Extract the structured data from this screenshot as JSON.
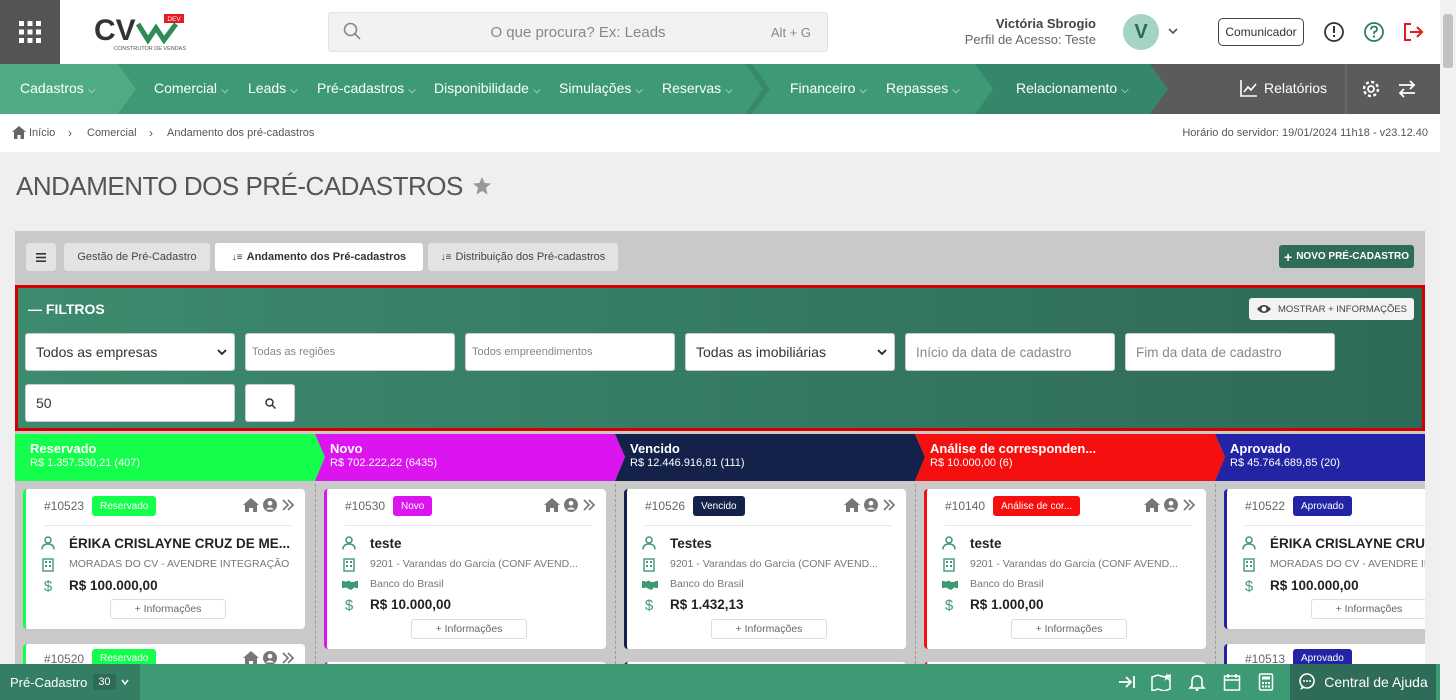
{
  "header": {
    "search_placeholder": "O que procura? Ex: Leads",
    "search_shortcut": "Alt + G",
    "user_name": "Victória Sbrogio",
    "user_profile": "Perfil de Acesso: Teste",
    "avatar_letter": "V",
    "communicator_label": "Comunicador",
    "logo_text": "CV",
    "logo_badge": "DEV",
    "logo_subtitle": "CONSTRUTOR DE VENDAS"
  },
  "nav": {
    "items": [
      "Cadastros",
      "Comercial",
      "Leads",
      "Pré-cadastros",
      "Disponibilidade",
      "Simulações",
      "Reservas",
      "Financeiro",
      "Repasses",
      "Relacionamento"
    ],
    "reports_label": "Relatórios"
  },
  "breadcrumb": {
    "items": [
      "Início",
      "Comercial",
      "Andamento dos pré-cadastros"
    ],
    "server_time": "Horário do servidor: 19/01/2024 11h18 - v23.12.40"
  },
  "page": {
    "title": "ANDAMENTO DOS PRÉ-CADASTROS"
  },
  "tabs": {
    "items": [
      "Gestão de Pré-Cadastro",
      "Andamento dos Pré-cadastros",
      "Distribuição dos Pré-cadastros"
    ],
    "active": "Andamento dos Pré-cadastros",
    "new_button": "NOVO PRÉ-CADASTRO"
  },
  "filters": {
    "title": "FILTROS",
    "more_info": "MOSTRAR + INFORMAÇÕES",
    "empresas": "Todos as empresas",
    "regioes_placeholder": "Todas as regiões",
    "empreendimentos_placeholder": "Todos empreendimentos",
    "imobiliarias": "Todas as imobiliárias",
    "data_inicio_placeholder": "Início da data de cadastro",
    "data_fim_placeholder": "Fim da data de cadastro",
    "limit_value": "50"
  },
  "columns": [
    {
      "name": "Reservado",
      "summary": "R$ 1.357.530,21 (407)",
      "color": "#14ff4c",
      "card": {
        "id": "#10523",
        "badge": "Reservado",
        "name": "ÉRIKA CRISLAYNE CRUZ DE ME...",
        "empreendimento": "MORADAS DO CV - AVENDRE INTEGRAÇÃO",
        "bank": "",
        "value": "R$ 100.000,00",
        "info": "+ Informações"
      },
      "card2": {
        "id": "#10520",
        "badge": "Reservado"
      }
    },
    {
      "name": "Novo",
      "summary": "R$ 702.222,22 (6435)",
      "color": "#dc14f0",
      "card": {
        "id": "#10530",
        "badge": "Novo",
        "name": "teste",
        "empreendimento": "9201 - Varandas do Garcia (CONF AVEND...",
        "bank": "Banco do Brasil",
        "value": "R$ 10.000,00",
        "info": "+ Informações"
      },
      "card2": {
        "id": "",
        "badge": ""
      }
    },
    {
      "name": "Vencido",
      "summary": "R$ 12.446.916,81 (111)",
      "color": "#14214b",
      "card": {
        "id": "#10526",
        "badge": "Vencido",
        "name": "Testes",
        "empreendimento": "9201 - Varandas do Garcia (CONF AVEND...",
        "bank": "Banco do Brasil",
        "value": "R$ 1.432,13",
        "info": "+ Informações"
      },
      "card2": {
        "id": "",
        "badge": ""
      }
    },
    {
      "name": "Análise de corresponden...",
      "summary": "R$ 10.000,00 (6)",
      "color": "#f50f0f",
      "card": {
        "id": "#10140",
        "badge": "Análise de cor...",
        "name": "teste",
        "empreendimento": "9201 - Varandas do Garcia (CONF AVEND...",
        "bank": "Banco do Brasil",
        "value": "R$ 1.000,00",
        "info": "+ Informações"
      },
      "card2": {
        "id": "",
        "badge": ""
      }
    },
    {
      "name": "Aprovado",
      "summary": "R$ 45.764.689,85 (20)",
      "color": "#2323a5",
      "card": {
        "id": "#10522",
        "badge": "Aprovado",
        "name": "ÉRIKA CRISLAYNE CRUZ DE ME...",
        "empreendimento": "MORADAS DO CV - AVENDRE INTEGRAÇÃO",
        "bank": "",
        "value": "R$ 100.000,00",
        "info": "+ Informações"
      },
      "card2": {
        "id": "#10513",
        "badge": "Aprovado"
      }
    }
  ],
  "bottom": {
    "module": "Pré-Cadastro",
    "count": "30",
    "help_label": "Central de Ajuda"
  }
}
